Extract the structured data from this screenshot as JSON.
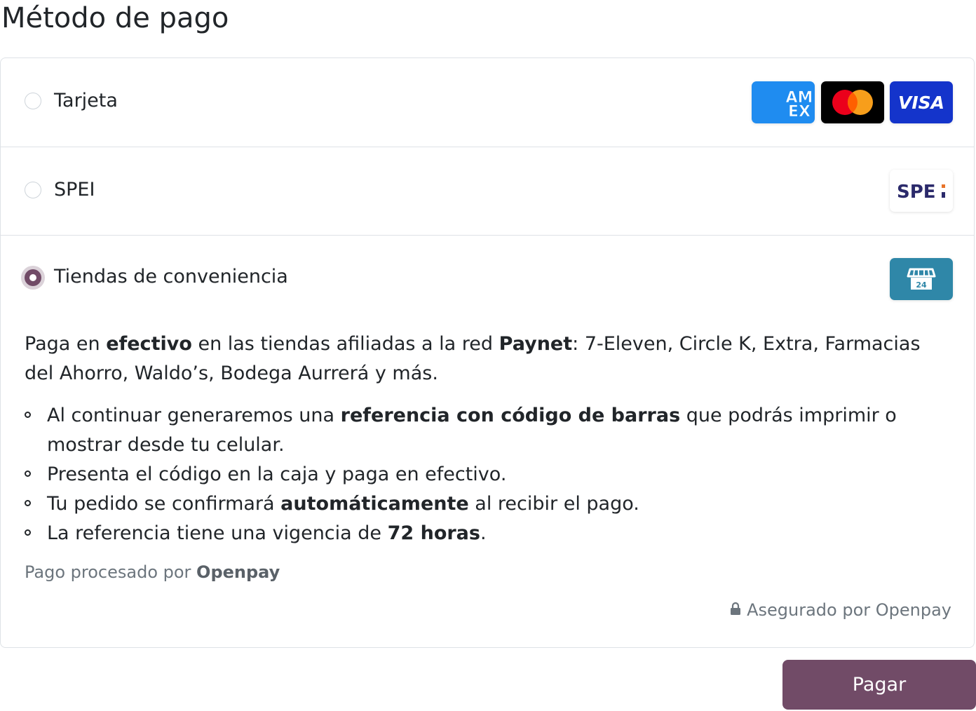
{
  "page": {
    "title": "Método de pago"
  },
  "methods": [
    {
      "label": "Tarjeta",
      "selected": false,
      "logos": [
        "amex-icon",
        "mastercard-icon",
        "visa-icon"
      ]
    },
    {
      "label": "SPEI",
      "selected": false,
      "logos": [
        "spei-icon"
      ]
    },
    {
      "label": "Tiendas de conveniencia",
      "selected": true,
      "logos": [
        "store-24-icon"
      ]
    }
  ],
  "logos": {
    "amex_line1": "AM",
    "amex_line2": "EX",
    "visa": "VISA",
    "spei": "SPE",
    "store_badge": "24"
  },
  "stores": {
    "desc_1": "Paga en ",
    "desc_2": "efectivo",
    "desc_3": " en las tiendas afiliadas a la red ",
    "desc_4": "Paynet",
    "desc_5": ": 7-Eleven, Circle K, Extra, Farmacias del Ahorro, Waldo’s, Bodega Aurrerá y más.",
    "steps": [
      {
        "a": "Al continuar generaremos una ",
        "b": "referencia con código de barras",
        "c": " que podrás imprimir o mostrar desde tu celular."
      },
      {
        "a": "Presenta el código en la caja y paga en efectivo.",
        "b": "",
        "c": ""
      },
      {
        "a": "Tu pedido se confirmará ",
        "b": "automáticamente",
        "c": " al recibir el pago."
      },
      {
        "a": "La referencia tiene una vigencia de ",
        "b": "72 horas",
        "c": "."
      }
    ],
    "processed_prefix": "Pago procesado por ",
    "processed_brand": "Openpay",
    "secured": "Asegurado por Openpay"
  },
  "actions": {
    "pay_label": "Pagar"
  },
  "colors": {
    "primary": "#714b67",
    "amex": "#1f8cf0",
    "visa": "#1434cb",
    "store": "#2f87a8",
    "border": "#dee2e6",
    "muted": "#6c757d"
  }
}
